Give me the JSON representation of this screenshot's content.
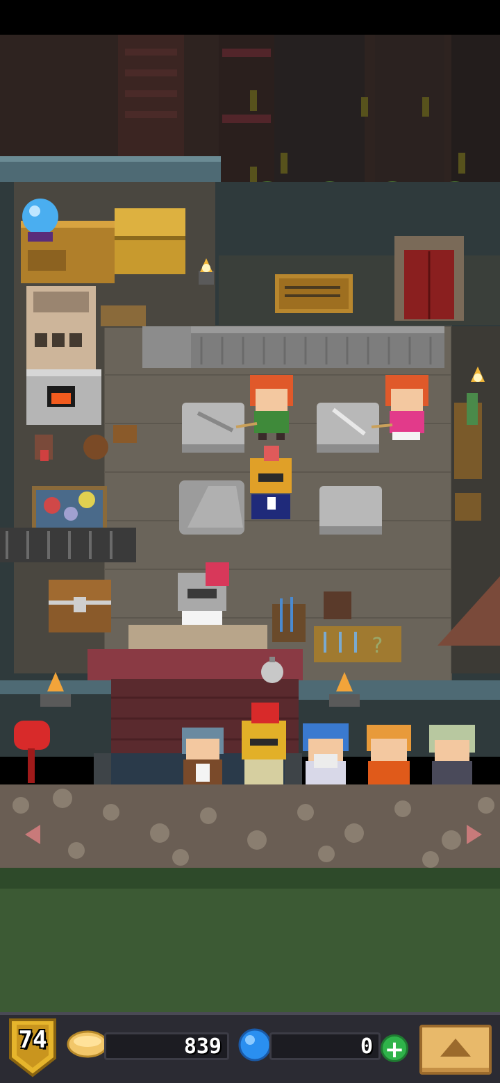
{
  "hud": {
    "level": "74",
    "coins": "839",
    "gems": "0",
    "add_gems_label": "+",
    "coin_icon": "gold-coin-icon",
    "gem_icon": "blue-gem-icon",
    "menu_icon": "triangle-up-icon"
  },
  "scene": {
    "npcs": [
      "shopkeeper-knight",
      "red-hair-girl-green",
      "red-hair-girl-pink",
      "spartan-helmet-kid"
    ],
    "queue": [
      "aviator-kid",
      "gold-helmet-knight",
      "blue-hair-elder",
      "orange-hair-kid",
      "grey-hair-elder"
    ]
  },
  "colors": {
    "hud_bg": "#2b2b33",
    "coin": "#f2c76a",
    "gem": "#2a8ff0",
    "plus": "#2fb34a",
    "menu_button": "#e8b96a"
  }
}
